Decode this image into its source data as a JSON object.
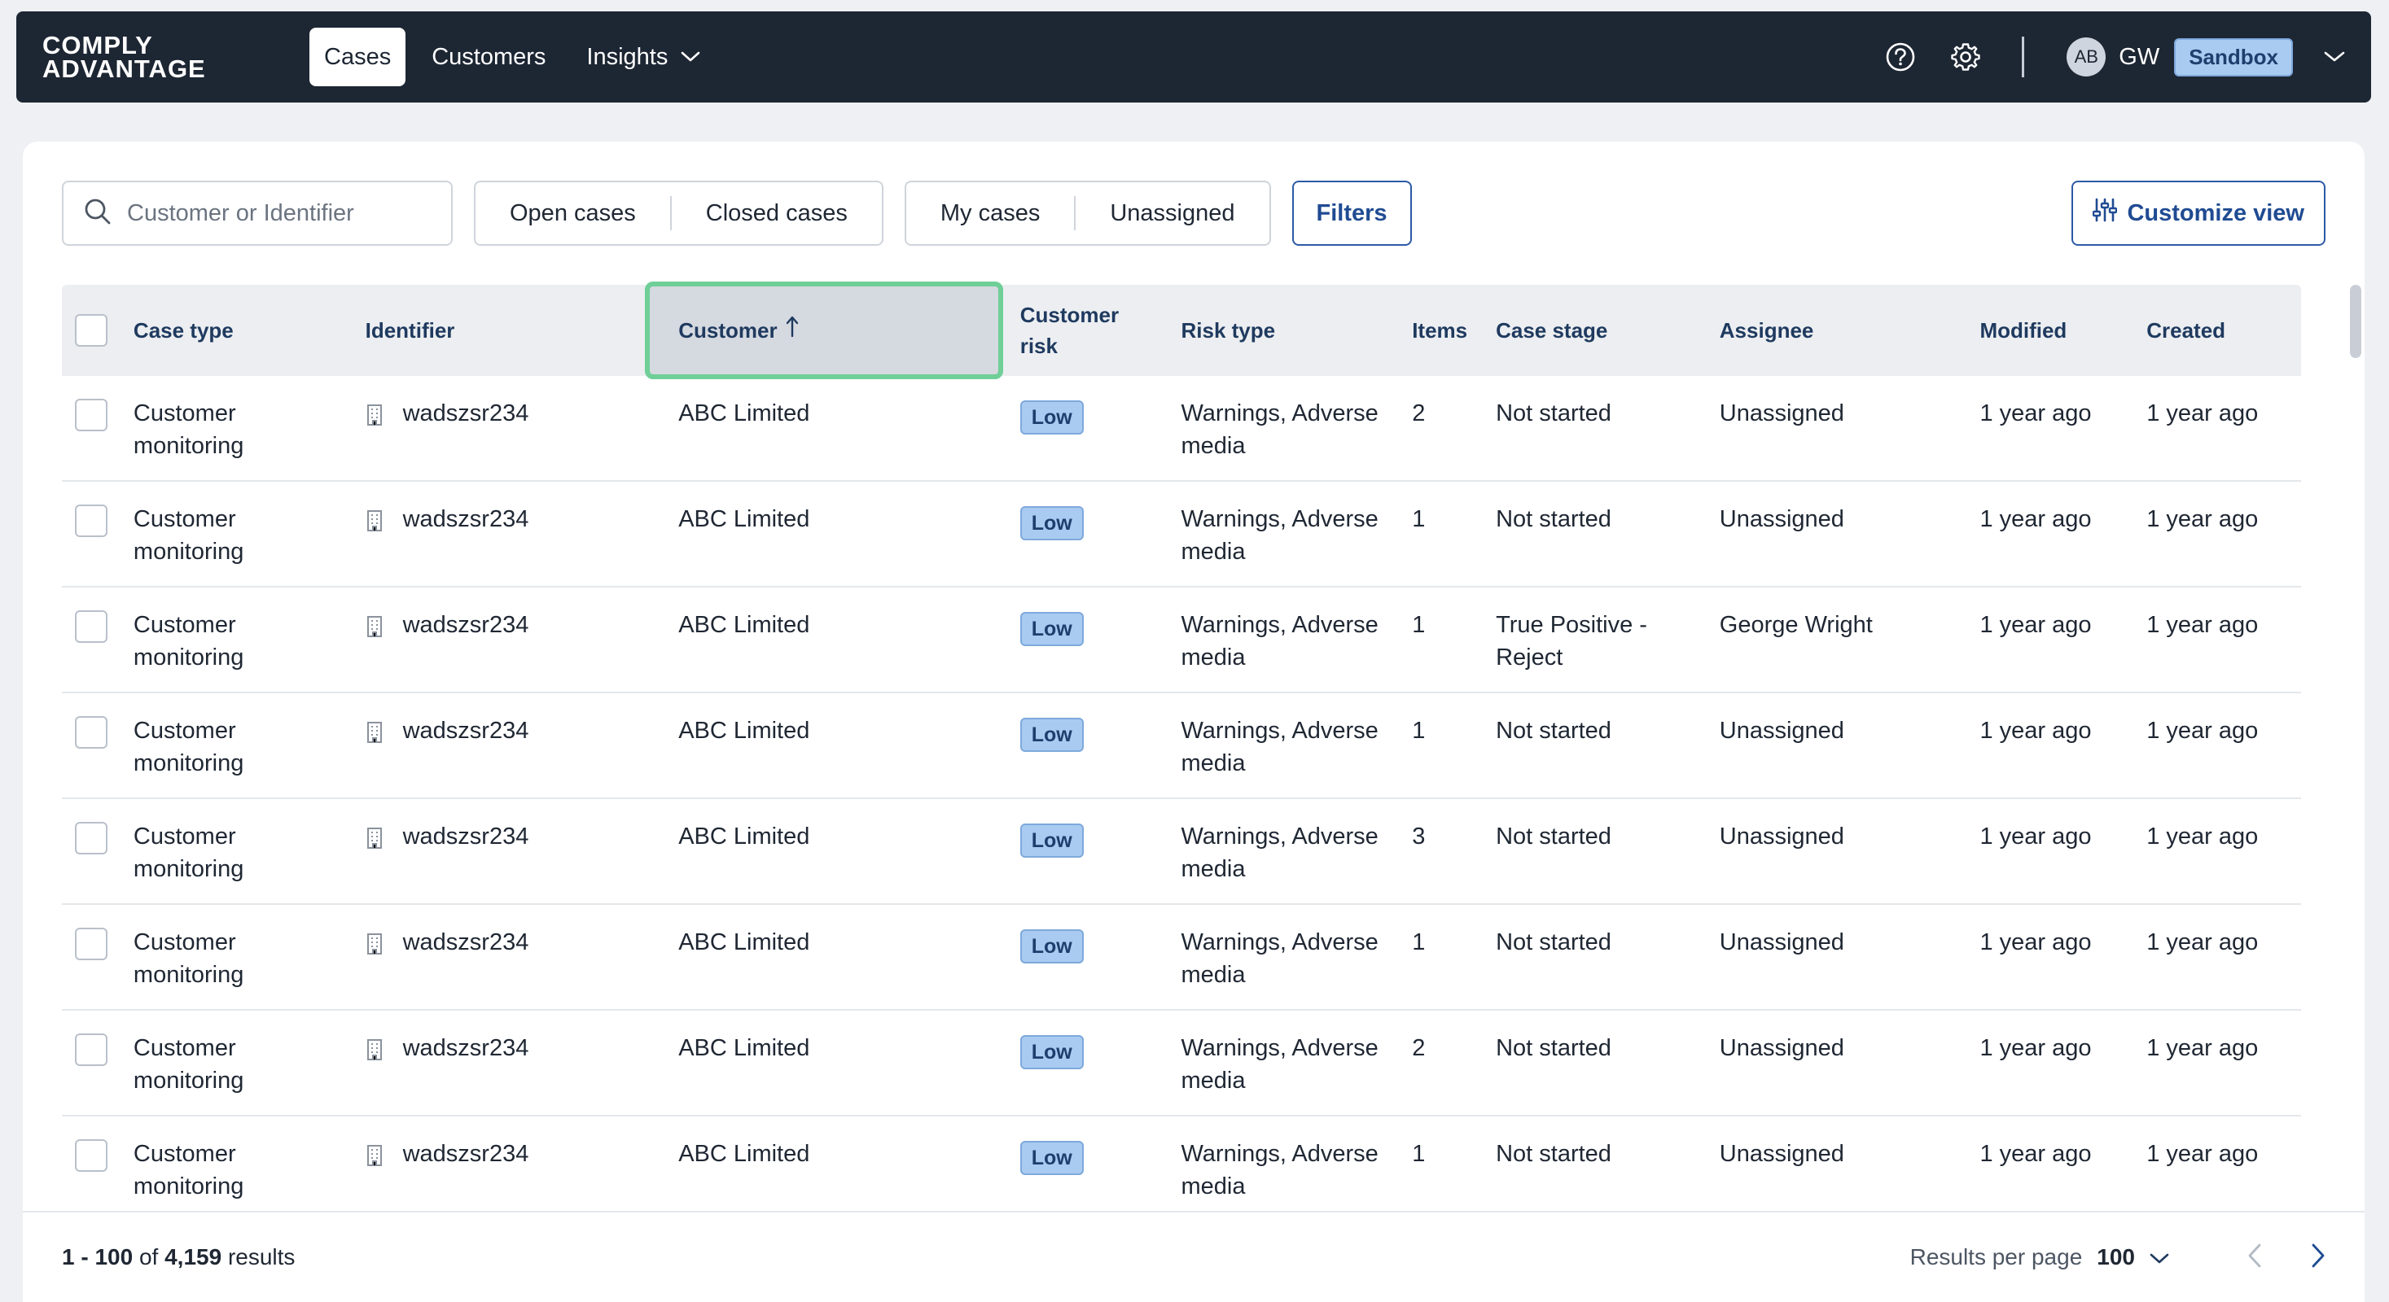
{
  "brand": {
    "line1": "COMPLY",
    "line2": "ADVANTAGE"
  },
  "nav": {
    "cases": "Cases",
    "customers": "Customers",
    "insights": "Insights"
  },
  "user": {
    "avatar": "AB",
    "initials": "GW",
    "environment": "Sandbox"
  },
  "toolbar": {
    "search_placeholder": "Customer or Identifier",
    "open_cases": "Open cases",
    "closed_cases": "Closed cases",
    "my_cases": "My cases",
    "unassigned": "Unassigned",
    "filters": "Filters",
    "customize_view": "Customize view"
  },
  "table": {
    "headers": {
      "case_type": "Case type",
      "identifier": "Identifier",
      "customer": "Customer",
      "customer_risk_1": "Customer",
      "customer_risk_2": "risk",
      "risk_type": "Risk type",
      "items": "Items",
      "case_stage": "Case stage",
      "assignee": "Assignee",
      "modified": "Modified",
      "created": "Created"
    },
    "sort": {
      "column": "Customer",
      "direction": "ascending"
    },
    "rows": [
      {
        "type1": "Customer",
        "type2": "monitoring",
        "identifier": "wadszsr234",
        "customer": "ABC Limited",
        "risk": "Low",
        "rtype1": "Warnings, Adverse",
        "rtype2": "media",
        "items": "2",
        "stage1": "Not started",
        "stage2": "",
        "assignee": "Unassigned",
        "modified": "1 year ago",
        "created": "1 year ago"
      },
      {
        "type1": "Customer",
        "type2": "monitoring",
        "identifier": "wadszsr234",
        "customer": "ABC Limited",
        "risk": "Low",
        "rtype1": "Warnings, Adverse",
        "rtype2": "media",
        "items": "1",
        "stage1": "Not started",
        "stage2": "",
        "assignee": "Unassigned",
        "modified": "1 year ago",
        "created": "1 year ago"
      },
      {
        "type1": "Customer",
        "type2": "monitoring",
        "identifier": "wadszsr234",
        "customer": "ABC Limited",
        "risk": "Low",
        "rtype1": "Warnings, Adverse",
        "rtype2": "media",
        "items": "1",
        "stage1": "True Positive -",
        "stage2": "Reject",
        "assignee": "George Wright",
        "modified": "1 year ago",
        "created": "1 year ago"
      },
      {
        "type1": "Customer",
        "type2": "monitoring",
        "identifier": "wadszsr234",
        "customer": "ABC Limited",
        "risk": "Low",
        "rtype1": "Warnings, Adverse",
        "rtype2": "media",
        "items": "1",
        "stage1": "Not started",
        "stage2": "",
        "assignee": "Unassigned",
        "modified": "1 year ago",
        "created": "1 year ago"
      },
      {
        "type1": "Customer",
        "type2": "monitoring",
        "identifier": "wadszsr234",
        "customer": "ABC Limited",
        "risk": "Low",
        "rtype1": "Warnings, Adverse",
        "rtype2": "media",
        "items": "3",
        "stage1": "Not started",
        "stage2": "",
        "assignee": "Unassigned",
        "modified": "1 year ago",
        "created": "1 year ago"
      },
      {
        "type1": "Customer",
        "type2": "monitoring",
        "identifier": "wadszsr234",
        "customer": "ABC Limited",
        "risk": "Low",
        "rtype1": "Warnings, Adverse",
        "rtype2": "media",
        "items": "1",
        "stage1": "Not started",
        "stage2": "",
        "assignee": "Unassigned",
        "modified": "1 year ago",
        "created": "1 year ago"
      },
      {
        "type1": "Customer",
        "type2": "monitoring",
        "identifier": "wadszsr234",
        "customer": "ABC Limited",
        "risk": "Low",
        "rtype1": "Warnings, Adverse",
        "rtype2": "media",
        "items": "2",
        "stage1": "Not started",
        "stage2": "",
        "assignee": "Unassigned",
        "modified": "1 year ago",
        "created": "1 year ago"
      },
      {
        "type1": "Customer",
        "type2": "monitoring",
        "identifier": "wadszsr234",
        "customer": "ABC Limited",
        "risk": "Low",
        "rtype1": "Warnings, Adverse",
        "rtype2": "media",
        "items": "1",
        "stage1": "Not started",
        "stage2": "",
        "assignee": "Unassigned",
        "modified": "1 year ago",
        "created": "1 year ago"
      }
    ]
  },
  "footer": {
    "range": "1 - 100",
    "of": "of",
    "total": "4,159",
    "results": "results",
    "rpp_label": "Results per page",
    "rpp_value": "100"
  },
  "colors": {
    "nav_bg": "#1d2633",
    "accent": "#2b5aa6",
    "badge_bg": "#a9cbf1",
    "sort_highlight": "#6fcf97"
  }
}
